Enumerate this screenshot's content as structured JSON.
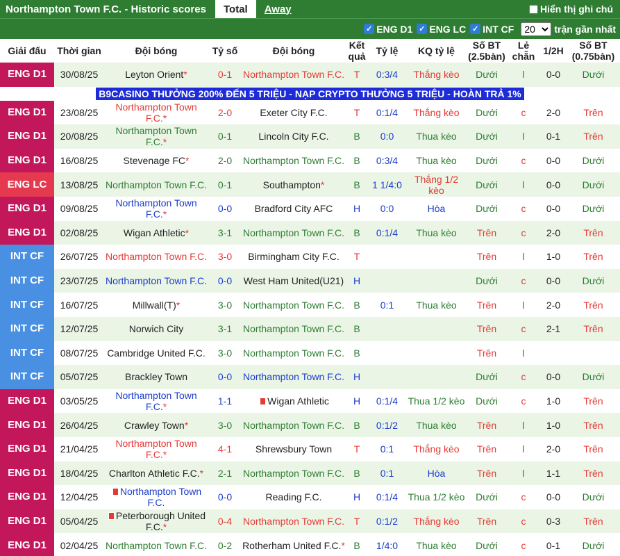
{
  "header": {
    "title": "Northampton Town F.C. - Historic scores",
    "tabs": [
      "Total",
      "Away"
    ],
    "show_note_label": "Hiển thị ghi chú"
  },
  "filters": {
    "leagues": [
      "ENG D1",
      "ENG LC",
      "INT CF"
    ],
    "recent_count": "20",
    "recent_label": "trận gần nhất"
  },
  "columns": [
    "Giải đấu",
    "Thời gian",
    "Đội bóng",
    "Tỷ số",
    "Đội bóng",
    "Kết quả",
    "Tỷ lệ",
    "KQ tỷ lệ",
    "Số BT (2.5bàn)",
    "Lẻ chẵn",
    "1/2H",
    "Số BT (0.75bàn)"
  ],
  "ad_text": "B9CASINO THƯỞNG 200% ĐẾN 5 TRIỆU - NẠP CRYPTO THƯỞNG 5 TRIỆU - HOÀN TRẢ 1%",
  "colors": {
    "ENG D1": "#c2185b",
    "ENG LC": "#e53950",
    "INT CF": "#4a90e2"
  },
  "rows": [
    {
      "league": "ENG D1",
      "date": "30/08/25",
      "home": "Leyton Orient",
      "home_star": true,
      "home_color": "black",
      "score": "0-1",
      "away": "Northampton Town F.C.",
      "away_color": "red",
      "result": "T",
      "odds": "0:3/4",
      "odds_result": "Thắng kèo",
      "ou": "Dưới",
      "oe": "l",
      "half": "0-0",
      "ou2": "Dưới"
    },
    {
      "league": "ENG D1",
      "date": "23/08/25",
      "home": "Northampton Town F.C.",
      "home_star": true,
      "home_color": "red",
      "score": "2-0",
      "away": "Exeter City F.C.",
      "away_color": "black",
      "result": "T",
      "odds": "0:1/4",
      "odds_result": "Thắng kèo",
      "ou": "Dưới",
      "oe": "c",
      "half": "2-0",
      "ou2": "Trên"
    },
    {
      "league": "ENG D1",
      "date": "20/08/25",
      "home": "Northampton Town F.C.",
      "home_star": true,
      "home_color": "green",
      "score": "0-1",
      "away": "Lincoln City F.C.",
      "away_color": "black",
      "result": "B",
      "odds": "0:0",
      "odds_result": "Thua kèo",
      "ou": "Dưới",
      "oe": "l",
      "half": "0-1",
      "ou2": "Trên"
    },
    {
      "league": "ENG D1",
      "date": "16/08/25",
      "home": "Stevenage FC",
      "home_star": true,
      "home_color": "black",
      "score": "2-0",
      "away": "Northampton Town F.C.",
      "away_color": "green",
      "result": "B",
      "odds": "0:3/4",
      "odds_result": "Thua kèo",
      "ou": "Dưới",
      "oe": "c",
      "half": "0-0",
      "ou2": "Dưới"
    },
    {
      "league": "ENG LC",
      "date": "13/08/25",
      "home": "Northampton Town F.C.",
      "home_star": false,
      "home_color": "green",
      "score": "0-1",
      "away": "Southampton",
      "away_star": true,
      "away_color": "black",
      "result": "B",
      "odds": "1 1/4:0",
      "odds_result": "Thắng 1/2 kèo",
      "ou": "Dưới",
      "oe": "l",
      "half": "0-0",
      "ou2": "Dưới"
    },
    {
      "league": "ENG D1",
      "date": "09/08/25",
      "home": "Northampton Town F.C.",
      "home_star": true,
      "home_color": "blue",
      "score": "0-0",
      "away": "Bradford City AFC",
      "away_color": "black",
      "result": "H",
      "odds": "0:0",
      "odds_result": "Hòa",
      "ou": "Dưới",
      "oe": "c",
      "half": "0-0",
      "ou2": "Dưới"
    },
    {
      "league": "ENG D1",
      "date": "02/08/25",
      "home": "Wigan Athletic",
      "home_star": true,
      "home_color": "black",
      "score": "3-1",
      "away": "Northampton Town F.C.",
      "away_color": "green",
      "result": "B",
      "odds": "0:1/4",
      "odds_result": "Thua kèo",
      "ou": "Trên",
      "oe": "c",
      "half": "2-0",
      "ou2": "Trên"
    },
    {
      "league": "INT CF",
      "date": "26/07/25",
      "home": "Northampton Town F.C.",
      "home_color": "red",
      "score": "3-0",
      "away": "Birmingham City F.C.",
      "away_color": "black",
      "result": "T",
      "odds": "",
      "odds_result": "",
      "ou": "Trên",
      "oe": "l",
      "half": "1-0",
      "ou2": "Trên"
    },
    {
      "league": "INT CF",
      "date": "23/07/25",
      "home": "Northampton Town F.C.",
      "home_color": "blue",
      "score": "0-0",
      "away": "West Ham United(U21)",
      "away_color": "black",
      "result": "H",
      "odds": "",
      "odds_result": "",
      "ou": "Dưới",
      "oe": "c",
      "half": "0-0",
      "ou2": "Dưới"
    },
    {
      "league": "INT CF",
      "date": "16/07/25",
      "home": "Millwall(T)",
      "home_star": true,
      "home_color": "black",
      "score": "3-0",
      "away": "Northampton Town F.C.",
      "away_color": "green",
      "result": "B",
      "odds": "0:1",
      "odds_result": "Thua kèo",
      "ou": "Trên",
      "oe": "l",
      "half": "2-0",
      "ou2": "Trên"
    },
    {
      "league": "INT CF",
      "date": "12/07/25",
      "home": "Norwich City",
      "home_color": "black",
      "score": "3-1",
      "away": "Northampton Town F.C.",
      "away_color": "green",
      "result": "B",
      "odds": "",
      "odds_result": "",
      "ou": "Trên",
      "oe": "c",
      "half": "2-1",
      "ou2": "Trên"
    },
    {
      "league": "INT CF",
      "date": "08/07/25",
      "home": "Cambridge United F.C.",
      "home_color": "black",
      "score": "3-0",
      "away": "Northampton Town F.C.",
      "away_color": "green",
      "result": "B",
      "odds": "",
      "odds_result": "",
      "ou": "Trên",
      "oe": "l",
      "half": "",
      "ou2": ""
    },
    {
      "league": "INT CF",
      "date": "05/07/25",
      "home": "Brackley Town",
      "home_color": "black",
      "score": "0-0",
      "away": "Northampton Town F.C.",
      "away_color": "blue",
      "result": "H",
      "odds": "",
      "odds_result": "",
      "ou": "Dưới",
      "oe": "c",
      "half": "0-0",
      "ou2": "Dưới"
    },
    {
      "league": "ENG D1",
      "date": "03/05/25",
      "home": "Northampton Town F.C.",
      "home_star": true,
      "home_color": "blue",
      "score": "1-1",
      "away": "Wigan Athletic",
      "away_card": true,
      "away_color": "black",
      "result": "H",
      "odds": "0:1/4",
      "odds_result": "Thua 1/2 kèo",
      "ou": "Dưới",
      "oe": "c",
      "half": "1-0",
      "ou2": "Trên"
    },
    {
      "league": "ENG D1",
      "date": "26/04/25",
      "home": "Crawley Town",
      "home_star": true,
      "home_color": "black",
      "score": "3-0",
      "away": "Northampton Town F.C.",
      "away_color": "green",
      "result": "B",
      "odds": "0:1/2",
      "odds_result": "Thua kèo",
      "ou": "Trên",
      "oe": "l",
      "half": "1-0",
      "ou2": "Trên"
    },
    {
      "league": "ENG D1",
      "date": "21/04/25",
      "home": "Northampton Town F.C.",
      "home_star": true,
      "home_color": "red",
      "score": "4-1",
      "away": "Shrewsbury Town",
      "away_color": "black",
      "result": "T",
      "odds": "0:1",
      "odds_result": "Thắng kèo",
      "ou": "Trên",
      "oe": "l",
      "half": "2-0",
      "ou2": "Trên"
    },
    {
      "league": "ENG D1",
      "date": "18/04/25",
      "home": "Charlton Athletic F.C.",
      "home_star": true,
      "home_color": "black",
      "score": "2-1",
      "away": "Northampton Town F.C.",
      "away_color": "green",
      "result": "B",
      "odds": "0:1",
      "odds_result": "Hòa",
      "ou": "Trên",
      "oe": "l",
      "half": "1-1",
      "ou2": "Trên"
    },
    {
      "league": "ENG D1",
      "date": "12/04/25",
      "home": "Northampton Town F.C.",
      "home_card": true,
      "home_color": "blue",
      "score": "0-0",
      "away": "Reading F.C.",
      "away_color": "black",
      "result": "H",
      "odds": "0:1/4",
      "odds_result": "Thua 1/2 kèo",
      "ou": "Dưới",
      "oe": "c",
      "half": "0-0",
      "ou2": "Dưới"
    },
    {
      "league": "ENG D1",
      "date": "05/04/25",
      "home": "Peterborough United F.C.",
      "home_card": true,
      "home_star": true,
      "home_color": "black",
      "score": "0-4",
      "away": "Northampton Town F.C.",
      "away_color": "red",
      "result": "T",
      "odds": "0:1/2",
      "odds_result": "Thắng kèo",
      "ou": "Trên",
      "oe": "c",
      "half": "0-3",
      "ou2": "Trên"
    },
    {
      "league": "ENG D1",
      "date": "02/04/25",
      "home": "Northampton Town F.C.",
      "home_color": "green",
      "score": "0-2",
      "away": "Rotherham United F.C.",
      "away_star": true,
      "away_color": "black",
      "result": "B",
      "odds": "1/4:0",
      "odds_result": "Thua kèo",
      "ou": "Dưới",
      "oe": "c",
      "half": "0-1",
      "ou2": "Dưới"
    }
  ]
}
